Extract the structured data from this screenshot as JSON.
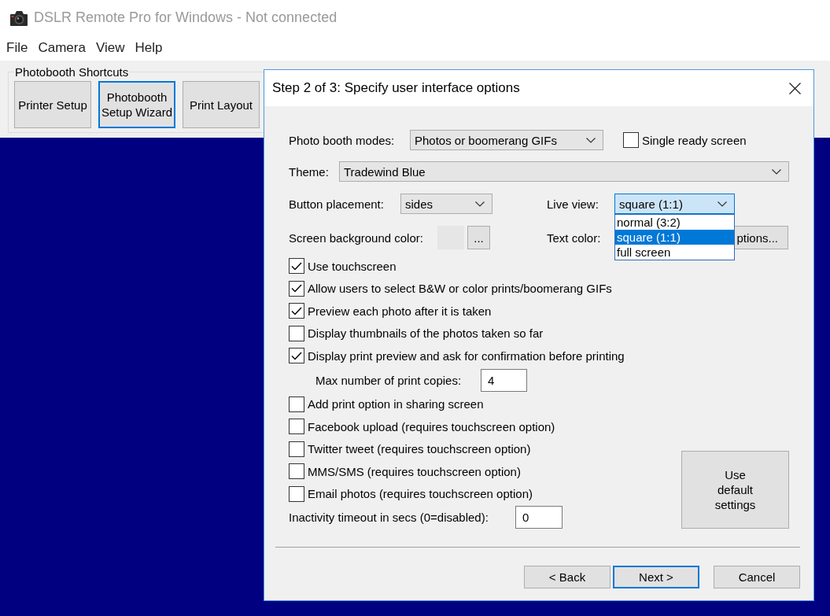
{
  "window": {
    "title": "DSLR Remote Pro for Windows - Not connected"
  },
  "menu": [
    "File",
    "Camera",
    "View",
    "Help"
  ],
  "shortcuts": {
    "title": "Photobooth Shortcuts",
    "buttons": [
      {
        "label": "Printer Setup",
        "focused": false
      },
      {
        "label": "Photobooth Setup Wizard",
        "focused": true
      },
      {
        "label": "Print Layout",
        "focused": false
      }
    ]
  },
  "dialog": {
    "title": "Step 2 of 3: Specify user interface options",
    "photo_booth_modes": {
      "label": "Photo booth modes:",
      "value": "Photos or boomerang GIFs"
    },
    "single_ready_screen": {
      "label": "Single ready screen",
      "checked": false
    },
    "theme": {
      "label": "Theme:",
      "value": "Tradewind Blue"
    },
    "button_placement": {
      "label": "Button placement:",
      "value": "sides"
    },
    "live_view": {
      "label": "Live view:",
      "value": "square (1:1)",
      "expanded": true,
      "options": [
        {
          "label": "normal (3:2)",
          "selected": false
        },
        {
          "label": "square (1:1)",
          "selected": true
        },
        {
          "label": "full screen",
          "selected": false
        }
      ]
    },
    "screen_background_color": {
      "label": "Screen background color:",
      "button": "..."
    },
    "text_color": {
      "label": "Text color:",
      "button": "ptions..."
    },
    "options": [
      {
        "label": "Use touchscreen",
        "checked": true
      },
      {
        "label": "Allow users to select B&W or color prints/boomerang GIFs",
        "checked": true
      },
      {
        "label": "Preview each photo after it is taken",
        "checked": true
      },
      {
        "label": "Display thumbnails of the photos taken so far",
        "checked": false
      },
      {
        "label": "Display print preview and ask for confirmation before printing",
        "checked": true,
        "children": [
          {
            "label": "Max number of print copies:",
            "value": "4"
          }
        ]
      },
      {
        "label": "Add print option in sharing screen",
        "checked": false
      },
      {
        "label": "Facebook upload (requires touchscreen option)",
        "checked": false
      },
      {
        "label": "Twitter tweet (requires touchscreen option)",
        "checked": false
      },
      {
        "label": "MMS/SMS (requires touchscreen option)",
        "checked": false
      },
      {
        "label": "Email photos (requires touchscreen option)",
        "checked": false
      }
    ],
    "inactivity_timeout": {
      "label": "Inactivity timeout in secs (0=disabled):",
      "value": "0"
    },
    "default_button": "Use default settings",
    "buttons": [
      {
        "label": "< Back",
        "focused": false
      },
      {
        "label": "Next >",
        "focused": true
      },
      {
        "label": "Cancel",
        "focused": false
      }
    ]
  }
}
